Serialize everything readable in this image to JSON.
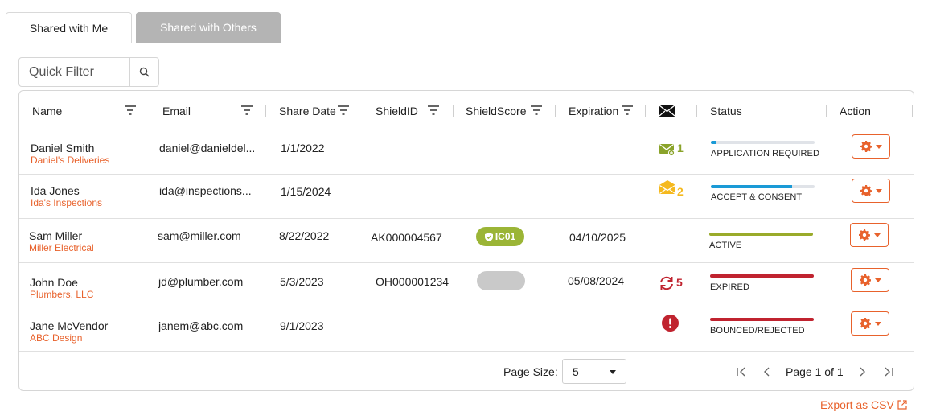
{
  "tabs": [
    {
      "label": "Shared with Me",
      "active": true
    },
    {
      "label": "Shared with Others",
      "active": false
    }
  ],
  "quick_filter": {
    "placeholder": "Quick Filter",
    "value": ""
  },
  "columns": [
    "Name",
    "Email",
    "Share Date",
    "ShieldID",
    "ShieldScore",
    "Expiration",
    "mail-icon",
    "Status",
    "Action"
  ],
  "rows": [
    {
      "name": "Daniel Smith",
      "company": "Daniel's Deliveries",
      "email": "daniel@danieldel...",
      "share_date": "1/1/2022",
      "shield_id": "",
      "shield_score": "",
      "expiration": "",
      "mail_count": "1",
      "mail_icon": "mail-add-icon",
      "status": "APPLICATION REQUIRED",
      "status_progress": 0.05,
      "status_color": "#1a9ad6"
    },
    {
      "name": "Ida Jones",
      "company": "Ida's Inspections",
      "email": "ida@inspections...",
      "share_date": "1/15/2024",
      "shield_id": "",
      "shield_score": "",
      "expiration": "",
      "mail_count": "2",
      "mail_icon": "mail-open-icon",
      "status": "ACCEPT & CONSENT",
      "status_progress": 0.78,
      "status_color": "#1a9ad6"
    },
    {
      "name": "Sam Miller",
      "company": "Miller Electrical",
      "email": "sam@miller.com",
      "share_date": "8/22/2022",
      "shield_id": "AK000004567",
      "shield_score": "IC01",
      "expiration": "04/10/2025",
      "mail_count": "",
      "mail_icon": "",
      "status": "ACTIVE",
      "status_progress": 1.0,
      "status_color": "#9aab2a"
    },
    {
      "name": "John Doe",
      "company": "Plumbers, LLC",
      "email": "jd@plumber.com",
      "share_date": "5/3/2023",
      "shield_id": "OH000001234",
      "shield_score": "",
      "expiration": "05/08/2024",
      "mail_count": "5",
      "mail_icon": "refresh-icon",
      "status": "EXPIRED",
      "status_progress": 1.0,
      "status_color": "#c0232f"
    },
    {
      "name": "Jane McVendor",
      "company": "ABC Design",
      "email": "janem@abc.com",
      "share_date": "9/1/2023",
      "shield_id": "",
      "shield_score": "",
      "expiration": "",
      "mail_count": "",
      "mail_icon": "error-icon",
      "status": "BOUNCED/REJECTED",
      "status_progress": 1.0,
      "status_color": "#c0232f"
    }
  ],
  "pagination": {
    "page_size_label": "Page Size:",
    "page_size": "5",
    "page_text": "Page 1 of 1"
  },
  "export": {
    "label": "Export as CSV"
  },
  "colors": {
    "accent": "#e8622c",
    "green_mail": "#8aa32a",
    "yellow_mail": "#f5b91e",
    "red": "#c0232f",
    "blue": "#1a9ad6"
  }
}
